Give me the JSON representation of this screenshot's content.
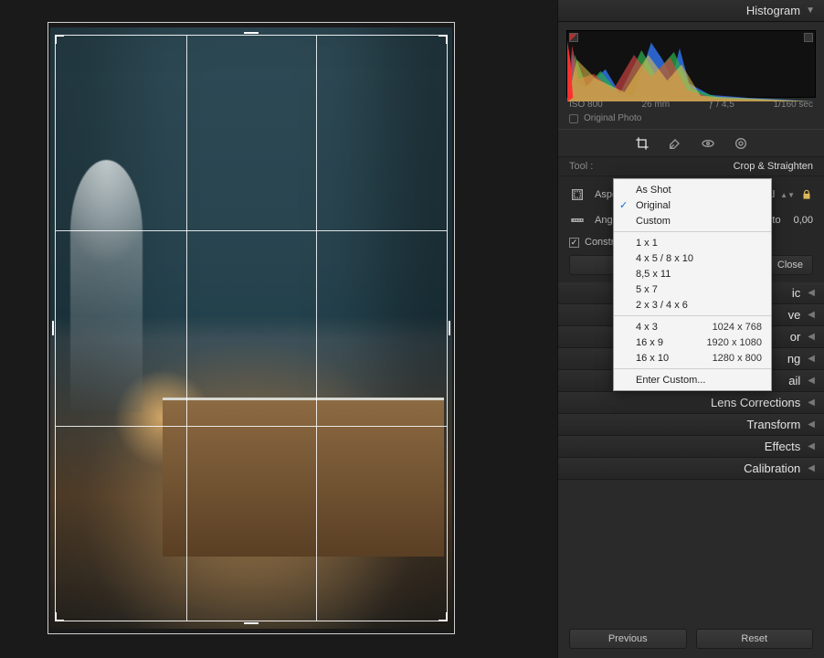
{
  "header": {
    "title": "Histogram"
  },
  "histogram": {
    "iso": "ISO 800",
    "focal": "26 mm",
    "aperture": "ƒ / 4,5",
    "shutter": "1/160 sec",
    "originalPhotoLabel": "Original Photo"
  },
  "toolstrip": {
    "tools": [
      "crop-icon",
      "spot-removal-icon",
      "redeye-icon",
      "radial-filter-icon"
    ]
  },
  "toolRow": {
    "label": "Tool :",
    "value": "Crop & Straighten"
  },
  "cropPanel": {
    "aspectLabel": "Aspect :",
    "aspectValue": "Original",
    "angleLabel": "Angle",
    "angleValue": "0,00",
    "autoLabel": "to",
    "constrainLabel": "Constrain t",
    "closeLabel": "Close"
  },
  "aspectMenu": {
    "items": [
      {
        "label": "As Shot"
      },
      {
        "label": "Original",
        "checked": true
      },
      {
        "label": "Custom"
      },
      {
        "sep": true
      },
      {
        "label": "1 x 1"
      },
      {
        "label": "4 x 5  /  8 x 10"
      },
      {
        "label": "8,5 x 11"
      },
      {
        "label": "5 x 7"
      },
      {
        "label": "2 x 3  /  4 x 6"
      },
      {
        "sep": true
      },
      {
        "label": "4 x 3",
        "res": "1024 x 768"
      },
      {
        "label": "16 x 9",
        "res": "1920 x 1080"
      },
      {
        "label": "16 x 10",
        "res": "1280 x 800"
      },
      {
        "sep": true
      },
      {
        "label": "Enter Custom..."
      }
    ]
  },
  "sections": {
    "partial": [
      {
        "tail": "ic"
      },
      {
        "tail": "ve"
      },
      {
        "tail": "or"
      },
      {
        "tail": "ng"
      },
      {
        "tail": "ail"
      }
    ],
    "full": [
      "Lens Corrections",
      "Transform",
      "Effects",
      "Calibration"
    ]
  },
  "footer": {
    "previous": "Previous",
    "reset": "Reset"
  }
}
